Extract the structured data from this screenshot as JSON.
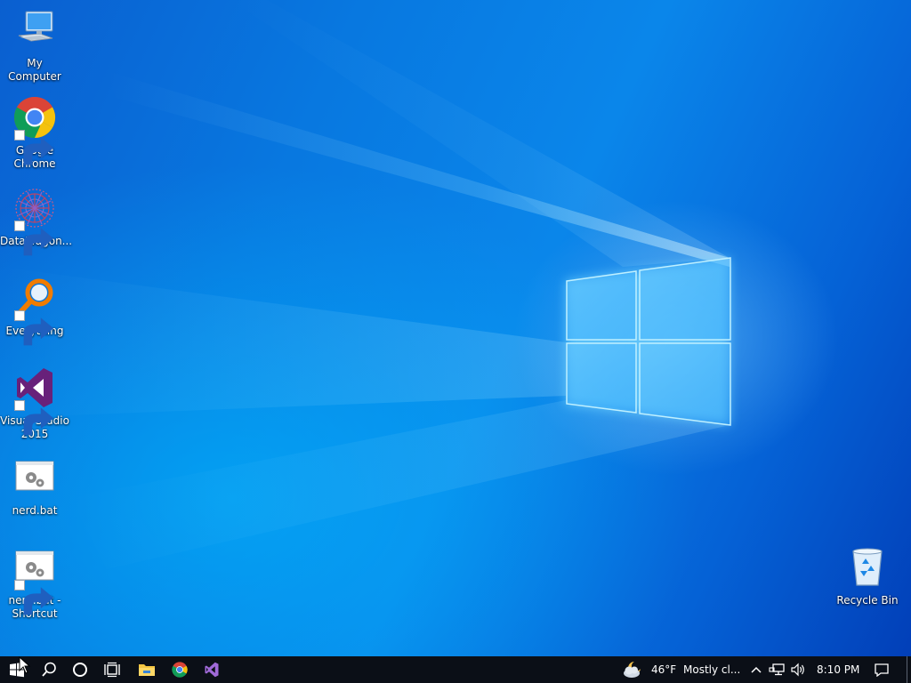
{
  "desktop_icons": [
    {
      "id": "my-computer",
      "label": "My Computer",
      "icon": "computer-icon",
      "shortcut": false
    },
    {
      "id": "google-chrome",
      "label": "Google\nChrome",
      "icon": "chrome-icon",
      "shortcut": true
    },
    {
      "id": "datawagon",
      "label": "DataWagon...",
      "icon": "datawagon-icon",
      "shortcut": true
    },
    {
      "id": "everything",
      "label": "Everything",
      "icon": "everything-icon",
      "shortcut": true
    },
    {
      "id": "visual-studio-2015",
      "label": "Visual Studio\n2015",
      "icon": "visual-studio-icon",
      "shortcut": true
    },
    {
      "id": "nerd-bat",
      "label": "nerd.bat",
      "icon": "batch-file-icon",
      "shortcut": false
    },
    {
      "id": "nerd-bat-shortcut",
      "label": "nerd.bat -\nShortcut",
      "icon": "batch-file-icon",
      "shortcut": true
    },
    {
      "id": "recycle-bin",
      "label": "Recycle Bin",
      "icon": "recycle-bin-icon",
      "shortcut": false
    }
  ],
  "taskbar": {
    "start_icon": "windows-start-icon",
    "search_icon": "search-icon",
    "cortana_icon": "cortana-circle-icon",
    "task_view_icon": "task-view-icon",
    "pinned_apps": [
      {
        "name": "File Explorer",
        "icon": "file-explorer-icon"
      },
      {
        "name": "Google Chrome",
        "icon": "chrome-icon"
      },
      {
        "name": "Visual Studio 2015",
        "icon": "visual-studio-icon"
      }
    ],
    "weather": {
      "icon": "cloudy-moon-icon",
      "temperature": "46°F",
      "condition": "Mostly cl..."
    },
    "tray": {
      "overflow_icon": "chevron-up-icon",
      "network_icon": "network-icon",
      "volume_icon": "volume-icon",
      "time": "8:10 PM",
      "notification_icon": "action-center-icon"
    }
  },
  "colors": {
    "wallpaper_primary": "#0878e0",
    "wallpaper_dark": "#023fb8",
    "taskbar_bg": "#0b0f17",
    "accent": "#7fb8ff"
  }
}
